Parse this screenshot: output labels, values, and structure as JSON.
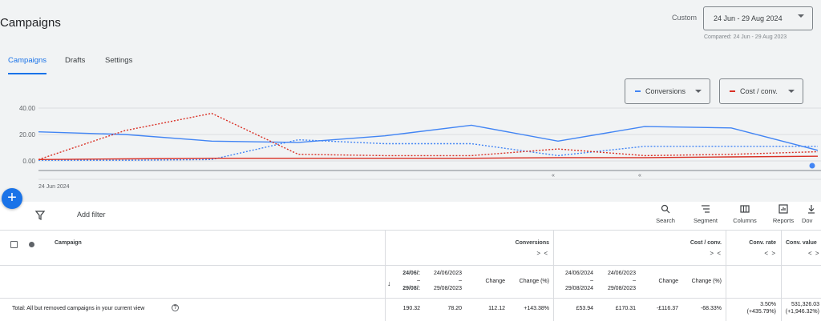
{
  "header": {
    "title": "Campaigns",
    "date_range_label": "Custom",
    "date_range_value": "24 Jun - 29 Aug 2024",
    "compared_text": "Compared: 24 Jun - 29 Aug 2023"
  },
  "tabs": [
    {
      "label": "Campaigns",
      "active": true
    },
    {
      "label": "Drafts",
      "active": false
    },
    {
      "label": "Settings",
      "active": false
    }
  ],
  "metrics": [
    {
      "label": "Conversions",
      "color": "#4285f4"
    },
    {
      "label": "Cost / conv.",
      "color": "#d93025"
    }
  ],
  "chart_data": {
    "type": "line",
    "x_start_label": "24 Jun 2024",
    "y_ticks": [
      "40.00",
      "20.00",
      "0.00"
    ],
    "ylim": [
      0,
      40
    ],
    "grid": true,
    "x": [
      0,
      1,
      2,
      3,
      4,
      5,
      6,
      7,
      8,
      9
    ],
    "series": [
      {
        "metric": "Conversions",
        "period": "current",
        "style": "solid",
        "color": "#4285f4",
        "values": [
          22,
          20,
          15,
          14,
          19,
          27,
          15,
          26,
          25,
          8
        ]
      },
      {
        "metric": "Conversions",
        "period": "comparison",
        "style": "dashed",
        "color": "#4285f4",
        "values": [
          0.5,
          0.5,
          1,
          16,
          13,
          13,
          4,
          11,
          11,
          11
        ]
      },
      {
        "metric": "Cost / conv.",
        "period": "current",
        "style": "solid",
        "color": "#d93025",
        "values": [
          1,
          1.5,
          2,
          2,
          2,
          2,
          2.5,
          2.5,
          3,
          3.5
        ]
      },
      {
        "metric": "Cost / conv.",
        "period": "comparison",
        "style": "dashed",
        "color": "#d93025",
        "values": [
          1,
          23,
          36,
          5,
          4,
          4,
          9,
          4,
          5,
          7
        ]
      }
    ]
  },
  "fab": {
    "label": "+"
  },
  "toolbar": {
    "add_filter": "Add filter",
    "search": "Search",
    "segment": "Segment",
    "columns": "Columns",
    "reports": "Reports",
    "download": "Dov"
  },
  "table": {
    "campaign_header": "Campaign",
    "groups": [
      {
        "label": "Conversions",
        "arrows": "> <"
      },
      {
        "label": "Cost / conv.",
        "arrows": "> <"
      },
      {
        "label": "Conv. rate",
        "arrows": "< >"
      },
      {
        "label": "Conv. value",
        "arrows": "< >"
      }
    ],
    "conv_sub": {
      "col1_top": "24/06/:",
      "col1_dash": "–",
      "col1_bottom": "29/08/:",
      "col2_top": "24/06/2023",
      "col2_dash": "–",
      "col2_bottom": "29/08/2023",
      "change": "Change",
      "change_pct": "Change (%)"
    },
    "cost_sub": {
      "col1_top": "24/06/2024",
      "col1_dash": "–",
      "col1_bottom": "29/08/2024",
      "col2_top": "24/06/2023",
      "col2_dash": "–",
      "col2_bottom": "29/08/2023",
      "change": "Change",
      "change_pct": "Change (%)"
    },
    "sort_arrow": "↓",
    "total_row": {
      "label": "Total: All but removed campaigns in your current view",
      "conv_current": "190.32",
      "conv_previous": "78.20",
      "conv_change": "112.12",
      "conv_change_pct": "+143.38%",
      "cost_current": "£53.94",
      "cost_previous": "£170.31",
      "cost_change": "-£116.37",
      "cost_change_pct": "-68.33%",
      "rate_value": "3.50%",
      "rate_change": "(+435.79%)",
      "value_value": "531,326.03",
      "value_change": "(+1,946.32%)"
    }
  }
}
